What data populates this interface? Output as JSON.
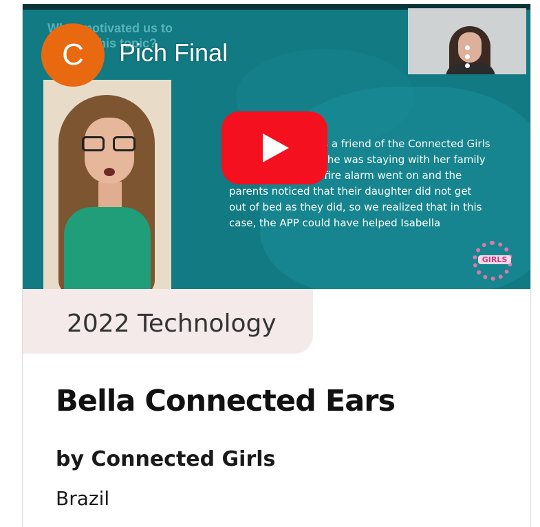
{
  "video": {
    "channel_initial": "C",
    "title": "Pich Final",
    "slide_heading": "What motivated us to choose this topic?",
    "slide_body": "Isabella Feinberg is a friend of the Connected Girls and she said that she was staying with her family and one night the fire alarm went on and the parents noticed that their daughter did not get out of bed as they did, so we realized that in this case, the APP could have helped Isabella",
    "logo_text": "GIRLS"
  },
  "card": {
    "category": "2022 Technology",
    "title": "Bella Connected Ears",
    "team": "by Connected Girls",
    "country": "Brazil"
  },
  "colors": {
    "accent_play": "#f4101e",
    "avatar": "#e8690f",
    "slide_bg": "#127a83",
    "tag_bg": "#f4eaea"
  },
  "icons": [
    "play-icon",
    "more-vert-icon",
    "channel-avatar"
  ]
}
